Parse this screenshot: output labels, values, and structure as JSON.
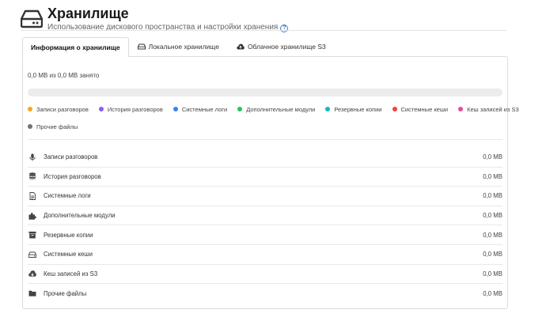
{
  "header": {
    "title": "Хранилище",
    "subtitle": "Использование дискового пространства и настройки хранения",
    "help_icon": "question-circle-icon"
  },
  "tabs": [
    {
      "label": "Информация о хранилище",
      "active": true,
      "icon": ""
    },
    {
      "label": "Локальное хранилище",
      "active": false,
      "icon": "hard-drive-icon"
    },
    {
      "label": "Облачное хранилище S3",
      "active": false,
      "icon": "cloud-upload-icon"
    }
  ],
  "usage": {
    "text": "0,0 MB из 0,0 MB занято",
    "percent_used": 0
  },
  "legend": [
    {
      "label": "Записи разговоров",
      "color": "#f5a623"
    },
    {
      "label": "История разговоров",
      "color": "#8b5cf6"
    },
    {
      "label": "Системные логи",
      "color": "#3b82f6"
    },
    {
      "label": "Дополнительные модули",
      "color": "#22c55e"
    },
    {
      "label": "Резервные копии",
      "color": "#14b8b8"
    },
    {
      "label": "Системные кеши",
      "color": "#ef4444"
    },
    {
      "label": "Кеш записей из S3",
      "color": "#ec4899"
    },
    {
      "label": "Прочие файлы",
      "color": "#6b7280"
    }
  ],
  "rows": [
    {
      "label": "Записи разговоров",
      "value": "0,0 MB",
      "icon": "microphone-icon"
    },
    {
      "label": "История разговоров",
      "value": "0,0 MB",
      "icon": "database-icon"
    },
    {
      "label": "Системные логи",
      "value": "0,0 MB",
      "icon": "file-text-icon"
    },
    {
      "label": "Дополнительные модули",
      "value": "0,0 MB",
      "icon": "puzzle-icon"
    },
    {
      "label": "Резервные копии",
      "value": "0,0 MB",
      "icon": "archive-icon"
    },
    {
      "label": "Системные кеши",
      "value": "0,0 MB",
      "icon": "hard-drive-icon"
    },
    {
      "label": "Кеш записей из S3",
      "value": "0,0 MB",
      "icon": "cloud-download-icon"
    },
    {
      "label": "Прочие файлы",
      "value": "0,0 MB",
      "icon": "folder-icon"
    }
  ]
}
